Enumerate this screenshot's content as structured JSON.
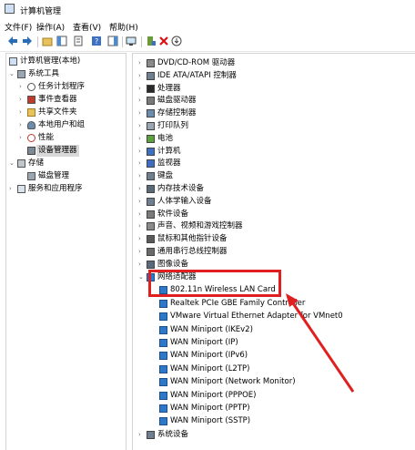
{
  "window": {
    "title": "计算机管理"
  },
  "menu": [
    "文件(F)",
    "操作(A)",
    "查看(V)",
    "帮助(H)"
  ],
  "left_tree": [
    {
      "label": "计算机管理(本地)",
      "arrow": "",
      "icon": "computer-icon"
    },
    {
      "label": "系统工具",
      "arrow": "⌄",
      "icon": "tools-icon"
    },
    {
      "label": "任务计划程序",
      "arrow": "›",
      "icon": "clock-icon"
    },
    {
      "label": "事件查看器",
      "arrow": "›",
      "icon": "event-viewer-icon"
    },
    {
      "label": "共享文件夹",
      "arrow": "›",
      "icon": "shared-folder-icon"
    },
    {
      "label": "本地用户和组",
      "arrow": "›",
      "icon": "users-icon"
    },
    {
      "label": "性能",
      "arrow": "›",
      "icon": "performance-icon"
    },
    {
      "label": "设备管理器",
      "arrow": "",
      "icon": "device-manager-icon"
    },
    {
      "label": "存储",
      "arrow": "⌄",
      "icon": "storage-icon"
    },
    {
      "label": "磁盘管理",
      "arrow": "",
      "icon": "disk-icon"
    },
    {
      "label": "服务和应用程序",
      "arrow": "›",
      "icon": "services-icon"
    }
  ],
  "device_categories_top": [
    {
      "label": "DVD/CD-ROM 驱动器",
      "icon": "dvd-icon"
    },
    {
      "label": "IDE ATA/ATAPI 控制器",
      "icon": "ide-icon"
    },
    {
      "label": "处理器",
      "icon": "processor-icon"
    },
    {
      "label": "磁盘驱动器",
      "icon": "disk-drive-icon"
    },
    {
      "label": "存储控制器",
      "icon": "storage-controller-icon"
    },
    {
      "label": "打印队列",
      "icon": "printer-icon"
    },
    {
      "label": "电池",
      "icon": "battery-icon"
    },
    {
      "label": "计算机",
      "icon": "computer-icon"
    },
    {
      "label": "监视器",
      "icon": "monitor-icon"
    },
    {
      "label": "键盘",
      "icon": "keyboard-icon"
    },
    {
      "label": "内存技术设备",
      "icon": "memory-icon"
    },
    {
      "label": "人体学输入设备",
      "icon": "hid-icon"
    },
    {
      "label": "软件设备",
      "icon": "software-device-icon"
    },
    {
      "label": "声音、视频和游戏控制器",
      "icon": "sound-icon"
    },
    {
      "label": "鼠标和其他指针设备",
      "icon": "mouse-icon"
    },
    {
      "label": "通用串行总线控制器",
      "icon": "usb-icon"
    },
    {
      "label": "图像设备",
      "icon": "camera-icon"
    }
  ],
  "network_category": {
    "label": "网络适配器",
    "icon": "network-adapter-icon"
  },
  "network_adapters": [
    "802.11n Wireless LAN Card",
    "Realtek PCIe GBE Family Controller",
    "VMware Virtual Ethernet Adapter for VMnet0",
    "WAN Miniport (IKEv2)",
    "WAN Miniport (IP)",
    "WAN Miniport (IPv6)",
    "WAN Miniport (L2TP)",
    "WAN Miniport (Network Monitor)",
    "WAN Miniport (PPPOE)",
    "WAN Miniport (PPTP)",
    "WAN Miniport (SSTP)"
  ],
  "bottom_category": {
    "label": "系统设备",
    "icon": "system-device-icon"
  },
  "colors": {
    "highlight": "#e02020",
    "nic_icon": "#2d78c8",
    "selection": "#d9d9d9"
  }
}
